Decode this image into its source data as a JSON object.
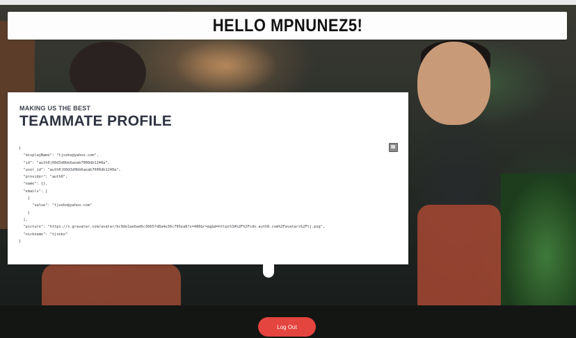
{
  "banner": {
    "greeting": "HELLO MPNUNEZ5!"
  },
  "profile_card": {
    "subtitle": "MAKING US THE BEST",
    "title": "TEAMMATE PROFILE",
    "profile_json": "{\n  \"displayName\": \"tjseko@yahoo.com\",\n  \"id\": \"auth0|60d3d0bb6aeab7000db1240a\",\n  \"user_id\": \"auth0|60d3d0bb6aeab7000db1240a\",\n  \"provider\": \"auth0\",\n  \"name\": {},\n  \"emails\": [\n    {\n      \"value\": \"tjseko@yahoo.com\"\n    }\n  ],\n  \"picture\": \"https://s.gravatar.com/avatar/bc9de1aebad6c3665fd8a4e36c795ea8?s=480&r=pg&d=https%3A%2F%2Fcdn.auth0.com%2Favatars%2Ftj.png\",\n  \"nickname\": \"tjseko\"\n}"
  },
  "actions": {
    "logout_label": "Log Out"
  },
  "colors": {
    "accent": "#e4453f",
    "card_bg": "#ffffff",
    "banner_bg": "#fdfdfd"
  },
  "icons": {
    "copy": "copy-icon"
  }
}
